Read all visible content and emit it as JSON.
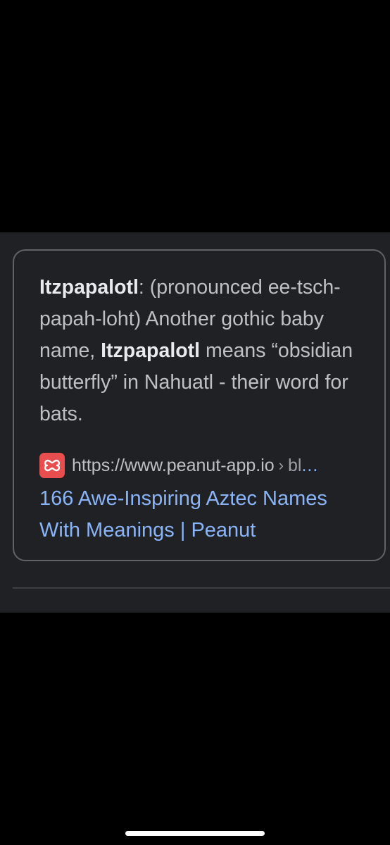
{
  "snippet": {
    "term1": "Itzpapalotl",
    "text1": ": (pronounced ee-tsch-papah-loht) Another gothic baby name, ",
    "term2": "Itzpapalotl",
    "text2": " means “obsidian butterfly” in Nahuatl - their word for bats."
  },
  "source": {
    "favicon": "peanut-logo-icon",
    "url": "https://www.peanut-app.io",
    "separator": "›",
    "path": "bl",
    "ellipsis": "..."
  },
  "result": {
    "title": "166 Awe-Inspiring Aztec Names With Meanings | Peanut"
  },
  "colors": {
    "background": "#000000",
    "panel": "#202124",
    "link": "#8ab4f8",
    "favicon": "#e94e4e"
  }
}
